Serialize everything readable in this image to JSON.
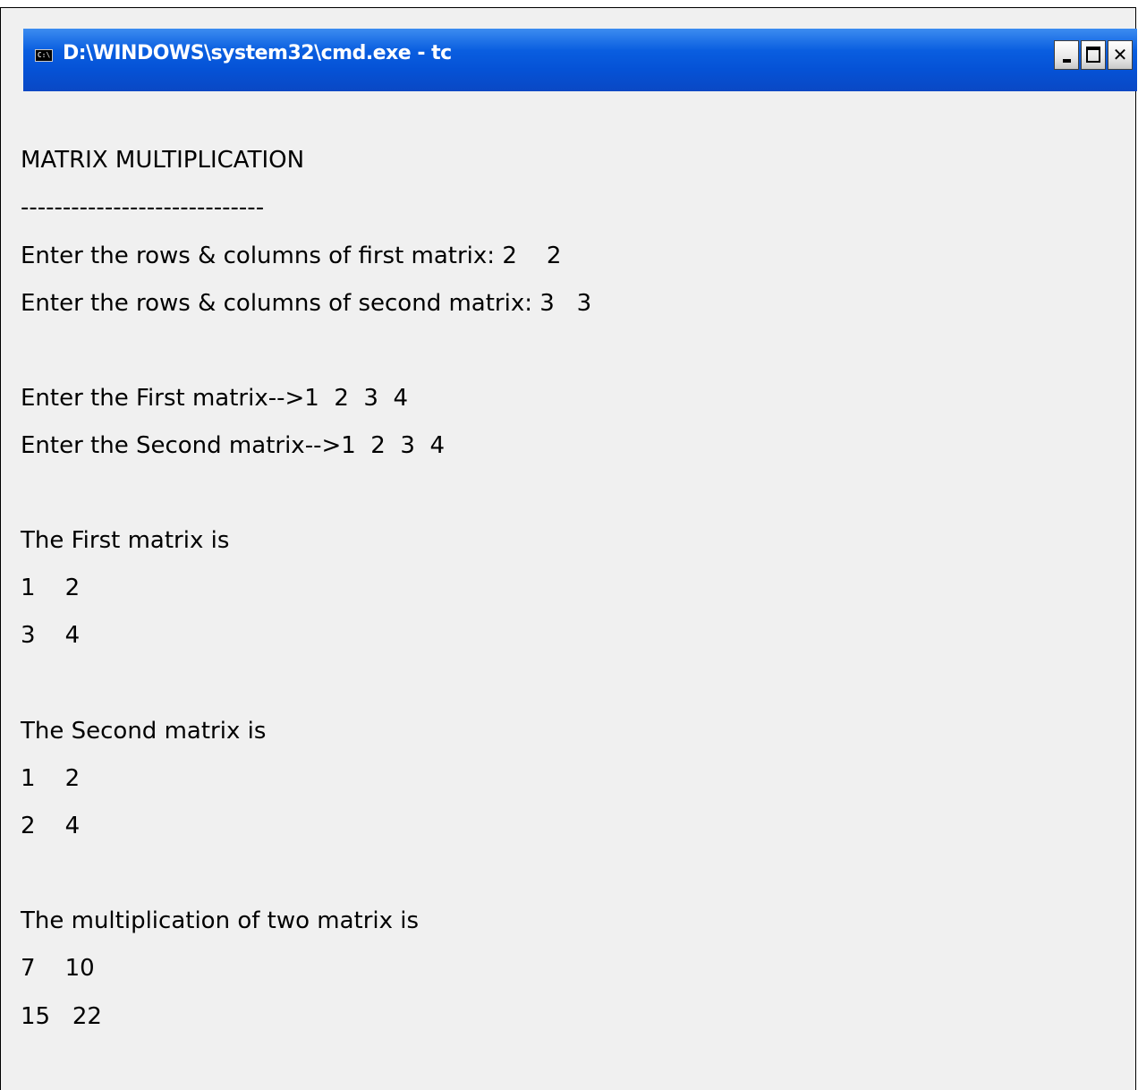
{
  "window": {
    "title": "D:\\WINDOWS\\system32\\cmd.exe - tc",
    "app_icon": "cmd-icon",
    "controls": {
      "minimize": "minimize-icon",
      "maximize": "maximize-icon",
      "close": "close-icon"
    }
  },
  "console": {
    "heading": "MATRIX MULTIPLICATION",
    "separator": "-----------------------------",
    "prompt_first_dims": "Enter the rows & columns of first matrix: 2    2",
    "prompt_second_dims": "Enter the rows & columns of second matrix: 3   3",
    "input_first": "Enter the First matrix-->1  2  3  4",
    "input_second": "Enter the Second matrix-->1  2  3  4",
    "first_label": "The First matrix is",
    "first_rows": [
      "1    2",
      "3    4"
    ],
    "second_label": "The Second matrix is",
    "second_rows": [
      "1    2",
      "2    4"
    ],
    "result_label": "The multiplication of two matrix is",
    "result_rows": [
      "7    10",
      "15   22"
    ]
  }
}
